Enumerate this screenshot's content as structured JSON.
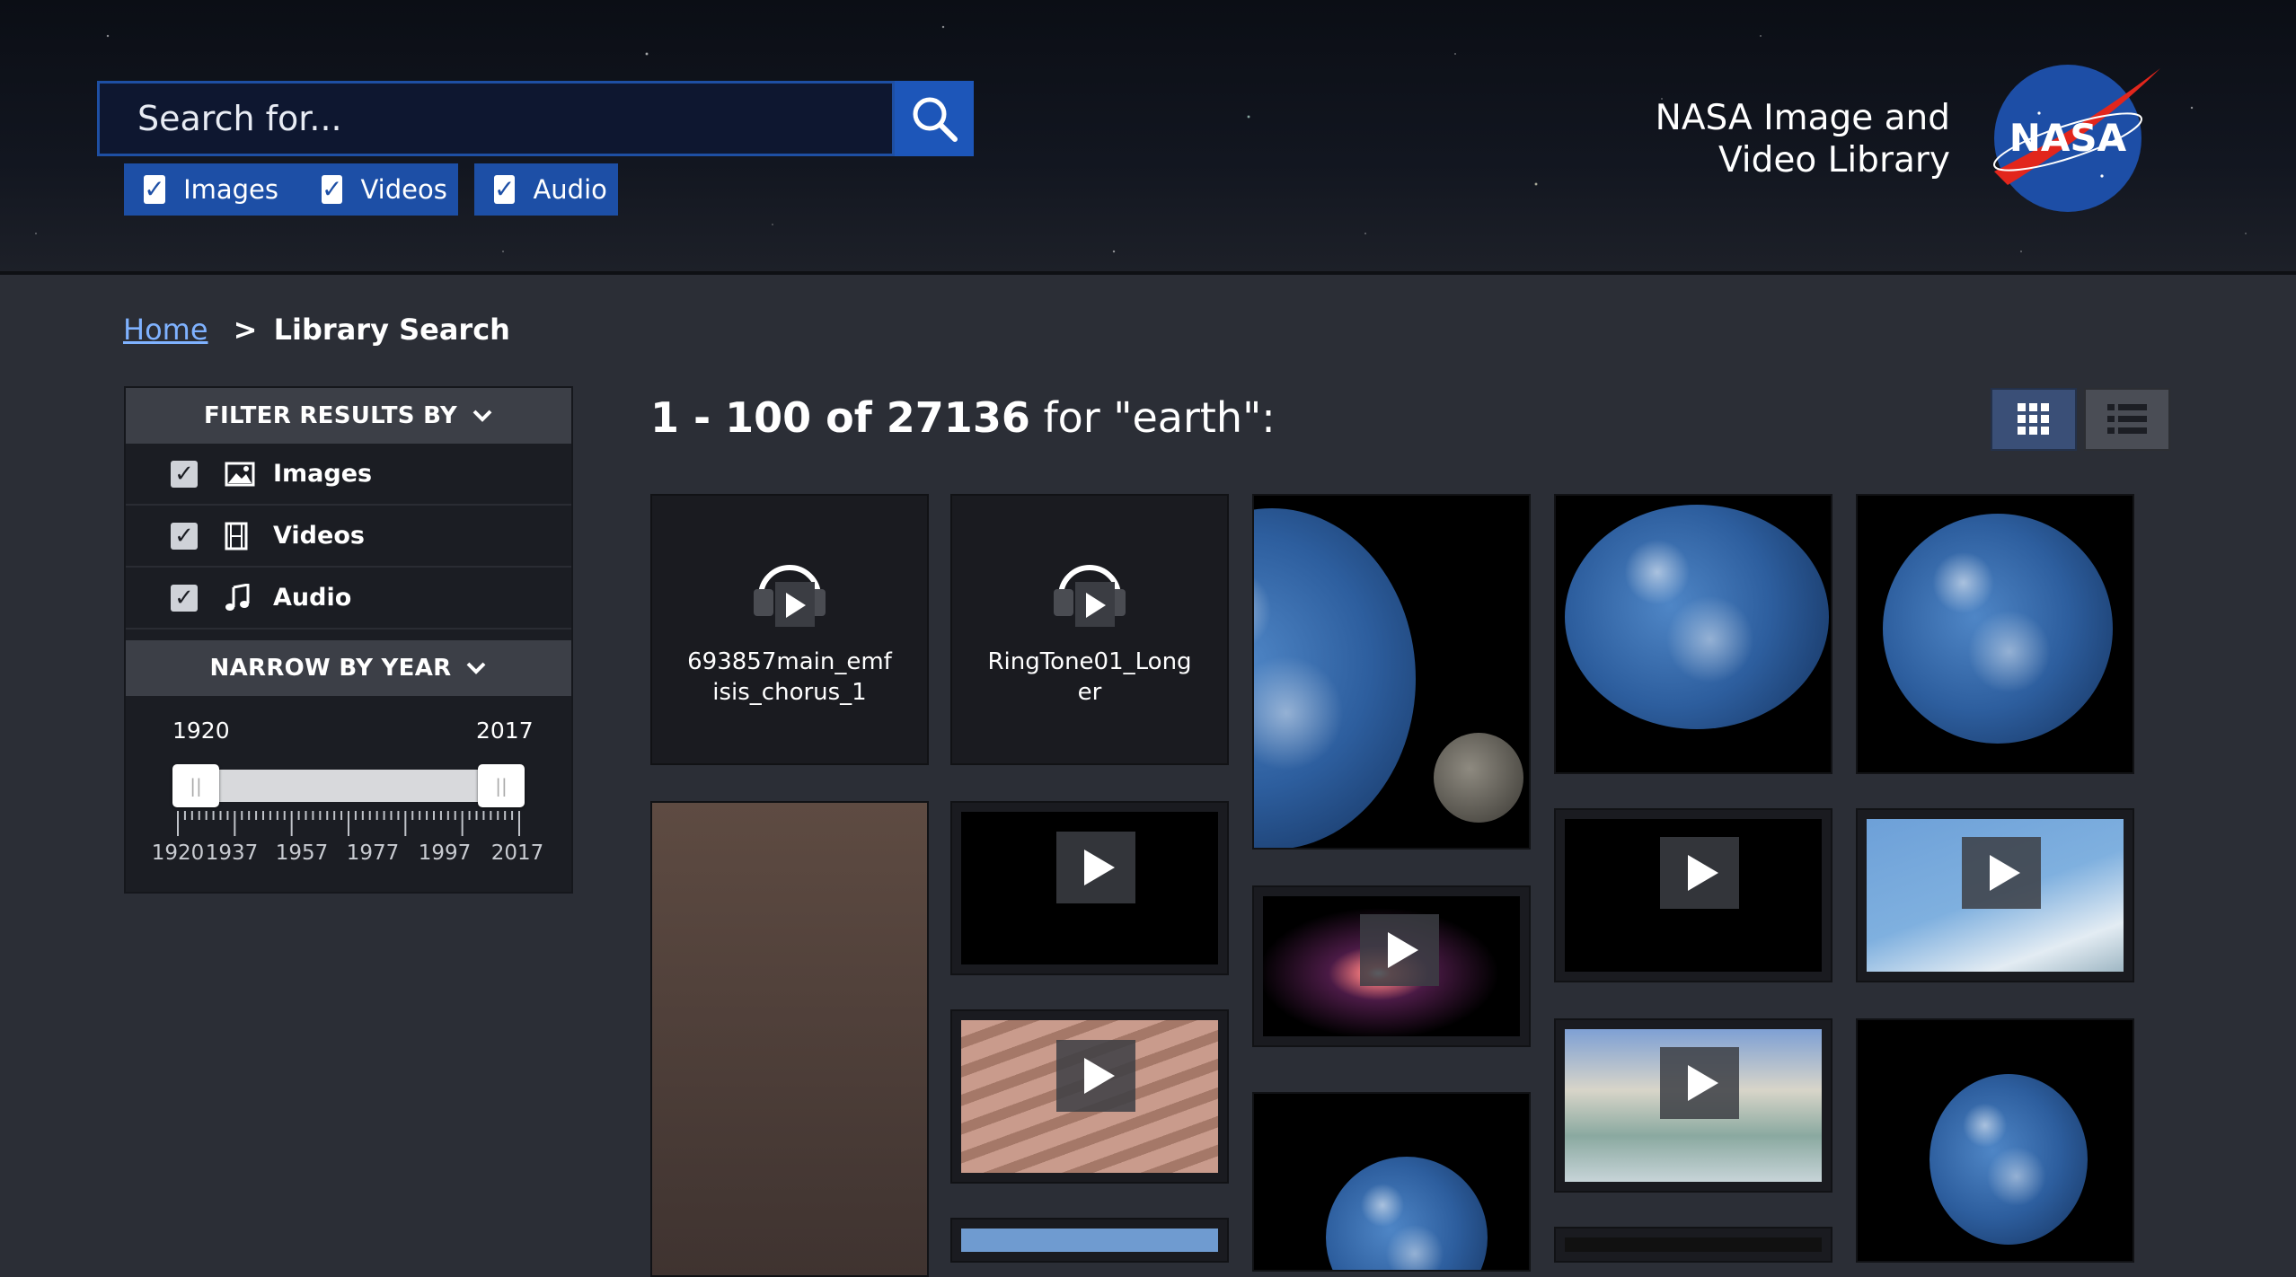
{
  "header": {
    "search_placeholder": "Search for...",
    "media_filters": [
      "Images",
      "Videos",
      "Audio"
    ],
    "site_title_line1": "NASA Image and",
    "site_title_line2": "Video Library",
    "logo_text": "NASA"
  },
  "breadcrumb": {
    "home": "Home",
    "separator": ">",
    "current": "Library Search"
  },
  "sidebar": {
    "filter_heading": "FILTER RESULTS BY",
    "filters": [
      "Images",
      "Videos",
      "Audio"
    ],
    "year_heading": "NARROW BY YEAR",
    "year_min": "1920",
    "year_max": "2017",
    "tick_labels": [
      "1920",
      "1937",
      "1957",
      "1977",
      "1997",
      "2017"
    ]
  },
  "results": {
    "range": "1 - 100 of 27136",
    "query": " for \"earth\":",
    "audio_titles": [
      "693857main_emfisis_chorus_1",
      "RingTone01_Longer"
    ]
  },
  "colors": {
    "accent": "#1d56b9",
    "background": "#2b2e36",
    "link": "#7fb2ff"
  }
}
